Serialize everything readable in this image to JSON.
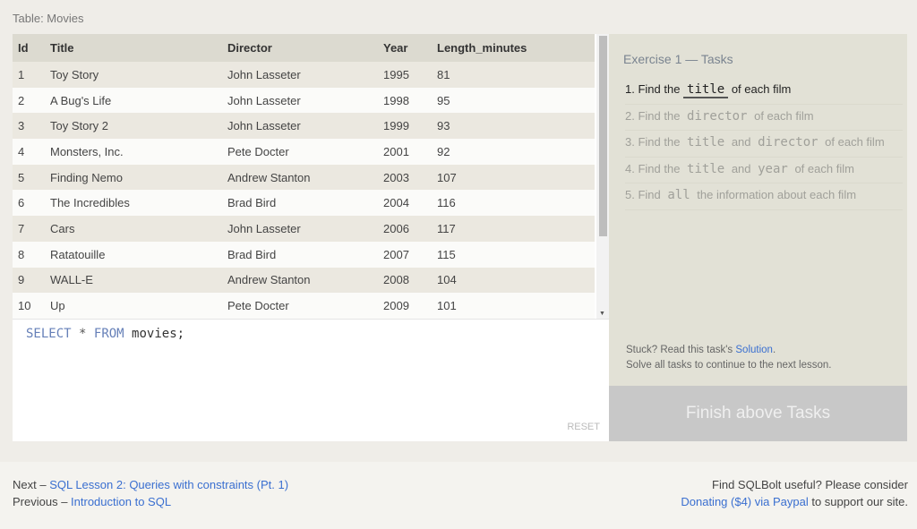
{
  "caption": "Table: Movies",
  "table": {
    "headers": [
      "Id",
      "Title",
      "Director",
      "Year",
      "Length_minutes"
    ],
    "rows": [
      [
        "1",
        "Toy Story",
        "John Lasseter",
        "1995",
        "81"
      ],
      [
        "2",
        "A Bug's Life",
        "John Lasseter",
        "1998",
        "95"
      ],
      [
        "3",
        "Toy Story 2",
        "John Lasseter",
        "1999",
        "93"
      ],
      [
        "4",
        "Monsters, Inc.",
        "Pete Docter",
        "2001",
        "92"
      ],
      [
        "5",
        "Finding Nemo",
        "Andrew Stanton",
        "2003",
        "107"
      ],
      [
        "6",
        "The Incredibles",
        "Brad Bird",
        "2004",
        "116"
      ],
      [
        "7",
        "Cars",
        "John Lasseter",
        "2006",
        "117"
      ],
      [
        "8",
        "Ratatouille",
        "Brad Bird",
        "2007",
        "115"
      ],
      [
        "9",
        "WALL-E",
        "Andrew Stanton",
        "2008",
        "104"
      ],
      [
        "10",
        "Up",
        "Pete Docter",
        "2009",
        "101"
      ]
    ]
  },
  "editor": {
    "kw1": "SELECT",
    "op": "*",
    "kw2": "FROM",
    "rest": "movies;",
    "reset": "RESET"
  },
  "side": {
    "title": "Exercise 1 — Tasks",
    "tasks": [
      {
        "parts": [
          "1. Find the ",
          "title",
          " of each film"
        ]
      },
      {
        "parts": [
          "2. Find the ",
          "director",
          " of each film"
        ]
      },
      {
        "parts": [
          "3. Find the ",
          "title",
          " and ",
          "director",
          " of each film"
        ]
      },
      {
        "parts": [
          "4. Find the ",
          "title",
          " and ",
          "year",
          " of each film"
        ]
      },
      {
        "parts": [
          "5. Find ",
          "all",
          " the information about each film"
        ]
      }
    ],
    "stuck_pre": "Stuck? Read this task's ",
    "stuck_link": "Solution",
    "stuck_post": ".",
    "solve": "Solve all tasks to continue to the next lesson.",
    "finish": "Finish above Tasks"
  },
  "footer": {
    "next_pre": "Next – ",
    "next_link": "SQL Lesson 2: Queries with constraints (Pt. 1)",
    "prev_pre": "Previous – ",
    "prev_link": "Introduction to SQL",
    "r1": "Find SQLBolt useful? Please consider",
    "donate_link": "Donating ($4) via Paypal",
    "r2": " to support our site."
  }
}
